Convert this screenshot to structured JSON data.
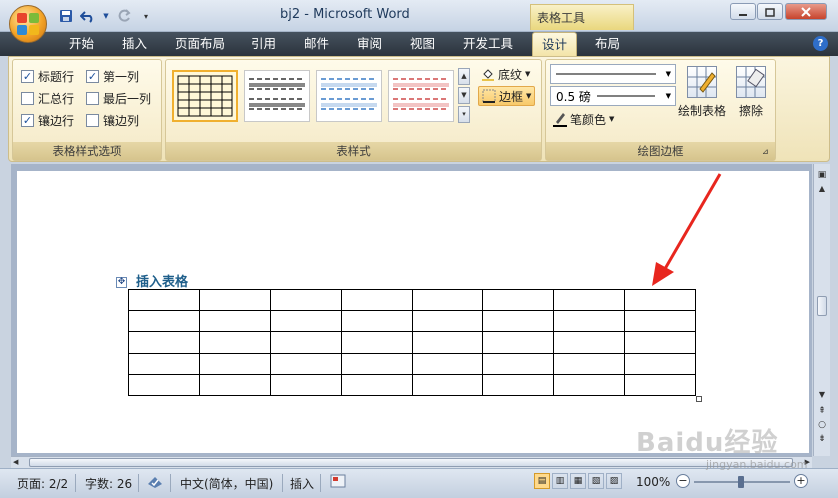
{
  "window": {
    "title": "bj2 - Microsoft Word",
    "context_tab_title": "表格工具"
  },
  "tabs": [
    {
      "label": "开始"
    },
    {
      "label": "插入"
    },
    {
      "label": "页面布局"
    },
    {
      "label": "引用"
    },
    {
      "label": "邮件"
    },
    {
      "label": "审阅"
    },
    {
      "label": "视图"
    },
    {
      "label": "开发工具"
    },
    {
      "label": "设计",
      "active": true
    },
    {
      "label": "布局"
    }
  ],
  "ribbon": {
    "style_options": {
      "label": "表格样式选项",
      "items": [
        {
          "label": "标题行",
          "checked": true
        },
        {
          "label": "第一列",
          "checked": true
        },
        {
          "label": "汇总行",
          "checked": false
        },
        {
          "label": "最后一列",
          "checked": false
        },
        {
          "label": "镶边行",
          "checked": true
        },
        {
          "label": "镶边列",
          "checked": false
        }
      ]
    },
    "table_styles": {
      "label": "表样式",
      "shading": "底纹",
      "borders": "边框"
    },
    "draw_borders": {
      "label": "绘图边框",
      "weight": "0.5 磅",
      "pen_color": "笔颜色",
      "draw_table": "绘制表格",
      "eraser": "擦除"
    }
  },
  "document": {
    "heading": "插入表格",
    "table": {
      "rows": 5,
      "cols": 8
    }
  },
  "status": {
    "page": "页面: 2/2",
    "words": "字数: 26",
    "language": "中文(简体，中国)",
    "mode": "插入",
    "zoom": "100%"
  },
  "watermark": {
    "main": "Baidu经验",
    "sub": "jingyan.baidu.com"
  },
  "colors": {
    "accent": "#2b333c",
    "selected_tab": "#f3e4a8",
    "arrow": "#e8261e",
    "heading": "#1f4e79"
  }
}
